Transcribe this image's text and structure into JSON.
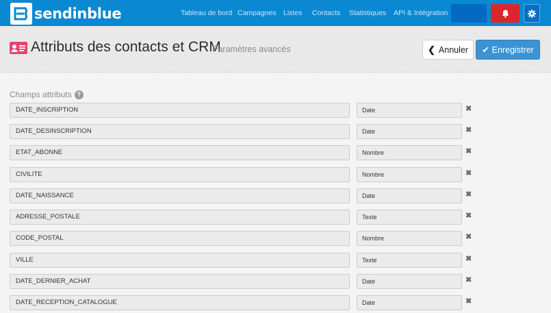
{
  "app": {
    "brand": "sendinblue",
    "colors": {
      "nav": "#0a88d2",
      "primary": "#3b93d4",
      "danger": "#d8282a",
      "icon": "#e8436b"
    }
  },
  "nav": {
    "items": [
      "Tableau de bord",
      "Campagnes",
      "Listes",
      "Contacts",
      "Statistiques",
      "API & Intégration"
    ],
    "icons": [
      "bell-icon",
      "gear-icon"
    ]
  },
  "header": {
    "title": "Attributs des contacts et CRM",
    "subtitle": "Paramètres avancés",
    "cancel_label": "Annuler",
    "save_label": "Enregistrer"
  },
  "section": {
    "label": "Champs attributs",
    "help": "?"
  },
  "attributes": [
    {
      "name": "DATE_INSCRIPTION",
      "type": "Date"
    },
    {
      "name": "DATE_DESINSCRIPTION",
      "type": "Date"
    },
    {
      "name": "ETAT_ABONNE",
      "type": "Nombre"
    },
    {
      "name": "CIVILITE",
      "type": "Nombre"
    },
    {
      "name": "DATE_NAISSANCE",
      "type": "Date"
    },
    {
      "name": "ADRESSE_POSTALE",
      "type": "Texte"
    },
    {
      "name": "CODE_POSTAL",
      "type": "Nombre"
    },
    {
      "name": "VILLE",
      "type": "Texte"
    },
    {
      "name": "DATE_DERNIER_ACHAT",
      "type": "Date"
    },
    {
      "name": "DATE_RECEPTION_CATALOGUE",
      "type": "Date"
    }
  ],
  "remove_glyph": "✖"
}
